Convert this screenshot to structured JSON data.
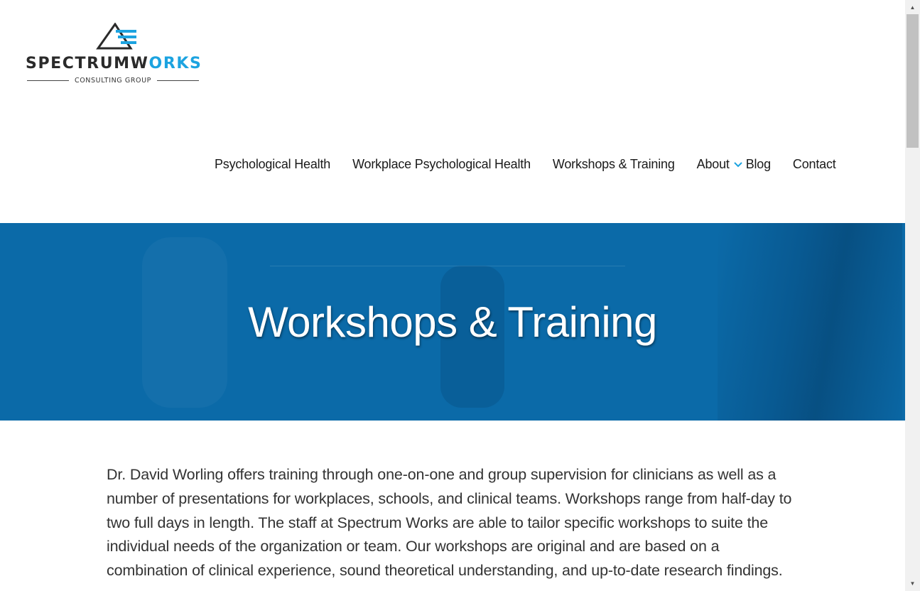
{
  "logo": {
    "word_part1": "SPECTRUMW",
    "word_o": "O",
    "word_part2": "RKS",
    "subtitle": "CONSULTING GROUP",
    "accent_color": "#1ca3e0",
    "dark_color": "#2a2a2a"
  },
  "nav": {
    "items": [
      {
        "label": "Psychological Health"
      },
      {
        "label": "Workplace Psychological Health"
      },
      {
        "label": "Workshops & Training"
      },
      {
        "label": "About",
        "icon": "chevron-down-icon"
      },
      {
        "label": "Blog"
      },
      {
        "label": "Contact"
      }
    ]
  },
  "hero": {
    "title": "Workshops & Training",
    "background_color": "#0b6aa8"
  },
  "content": {
    "paragraph": "Dr. David Worling offers training through one-on-one and group supervision for clinicians as well as a number of presentations for workplaces, schools, and clinical teams. Workshops range from half-day to two full days in length. The staff at Spectrum Works are able to tailor specific workshops to suite the individual needs of the organization or team. Our workshops are original and are based on a combination of clinical experience, sound theoretical understanding, and up-to-date research findings."
  },
  "scrollbar": {
    "up_icon": "scroll-up-arrow-icon",
    "down_icon": "scroll-down-arrow-icon"
  }
}
